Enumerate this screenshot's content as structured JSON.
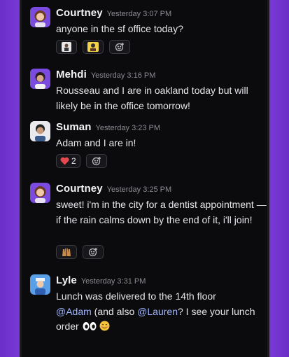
{
  "messages": [
    {
      "name": "Courtney",
      "time": "Yesterday 3:07 PM",
      "text": "anyone in the sf office today?"
    },
    {
      "name": "Mehdi",
      "time": "Yesterday 3:16 PM",
      "text": "Rousseau and I are in oakland today but will likely be in the office tomorrow!"
    },
    {
      "name": "Suman",
      "time": "Yesterday 3:23 PM",
      "text": "Adam and I are in!",
      "reaction_count": "2"
    },
    {
      "name": "Courtney",
      "time": "Yesterday 3:25 PM",
      "text": "sweet! i'm in the city for a dentist appointment — if the rain calms down by the end of it, i'll join!"
    },
    {
      "name": "Lyle",
      "time": "Yesterday 3:31 PM",
      "text_line1": "Lunch was delivered to the 14th floor",
      "mention_adam": "@Adam",
      "text_mid": " (and also ",
      "mention_lauren": "@Lauren",
      "text_end": "? I see your lunch order "
    }
  ],
  "icons": {
    "add_reaction": "add-reaction-icon",
    "heart": "heart-icon",
    "eyes": "eyes-icon",
    "smile": "smiling-face-icon"
  },
  "colors": {
    "background": "#0b0b0d",
    "mention": "#9db4ff",
    "frame": "#6a2fc6"
  }
}
